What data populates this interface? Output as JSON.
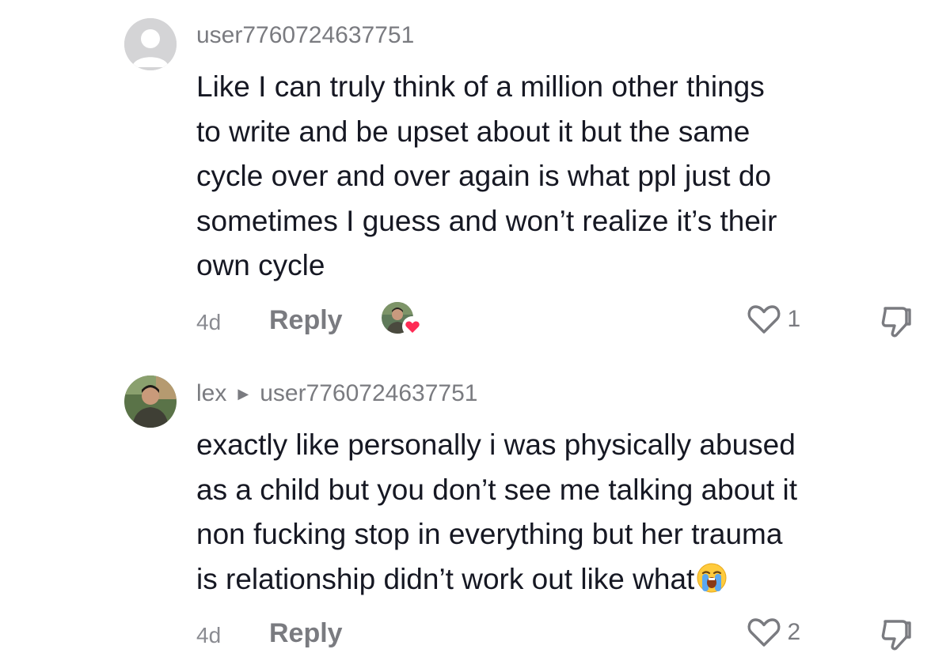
{
  "comments": [
    {
      "username": "user7760724637751",
      "text": "Like I can truly think of a million other things\nto write and be upset about it but the same\ncycle over and over again is what ppl just do\nsometimes I guess and won’t realize it’s their\nown cycle",
      "time": "4d",
      "reply_label": "Reply",
      "likes": "1",
      "liked_by_creator": true,
      "avatar_icon": "default-avatar-icon"
    },
    {
      "username": "lex",
      "reply_to": "user7760724637751",
      "text": "exactly like personally i was physically abused\nas a child but you don’t see me talking about it\nnon fucking stop in everything but her trauma\nis relationship didn’t work out like what",
      "emoji": "loudly-crying-face",
      "time": "4d",
      "reply_label": "Reply",
      "likes": "2",
      "liked_by_creator": false,
      "avatar_icon": "profile-photo"
    }
  ],
  "colors": {
    "text": "#161823",
    "secondary": "#7a7b80",
    "heart_badge": "#fe2c55",
    "default_avatar": "#d4d4d6"
  }
}
